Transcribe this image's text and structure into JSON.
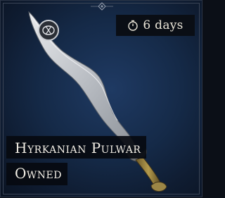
{
  "timer": {
    "icon": "stopwatch-icon",
    "label": "6 days"
  },
  "item": {
    "name": "Hyrkanian Pulwar",
    "status": "Owned",
    "image": "scimitar-sword-icon"
  },
  "colors": {
    "background": "#152a48",
    "label_bg": "#060a10",
    "text": "#f3efe6"
  }
}
